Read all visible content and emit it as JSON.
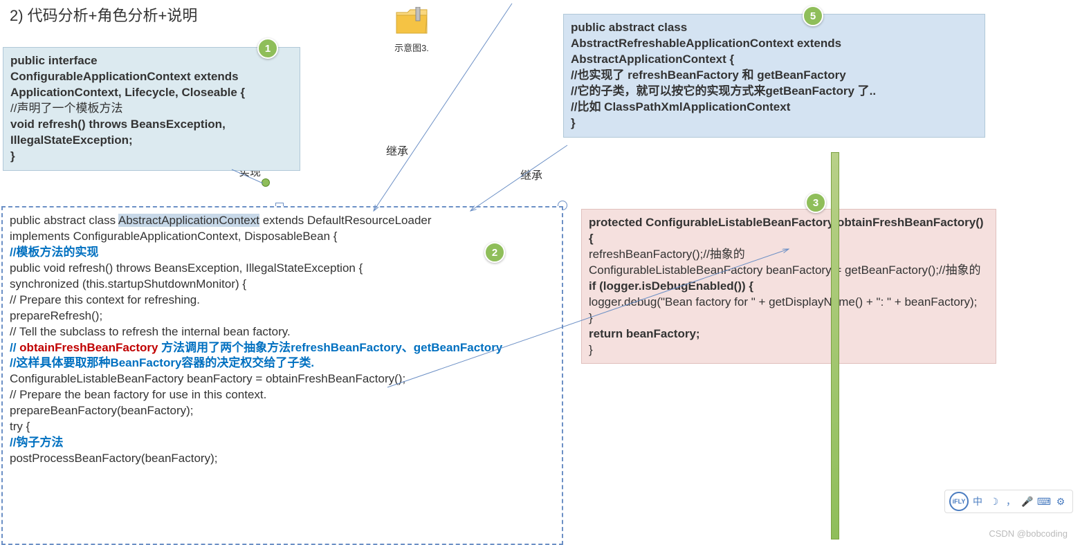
{
  "title": "2)  代码分析+角色分析+说明",
  "folder": {
    "label": "示意图3."
  },
  "labels": {
    "extends1": "继承",
    "extends2": "继承",
    "implements": "实现"
  },
  "box1": {
    "l1": "public interface",
    "l2": "ConfigurableApplicationContext extends",
    "l3": "ApplicationContext, Lifecycle, Closeable {",
    "l4": "//声明了一个模板方法",
    "l5": "void refresh() throws BeansException,",
    "l6": "IllegalStateException;",
    "l7": "}"
  },
  "box5": {
    "l1": "public abstract class",
    "l2": "AbstractRefreshableApplicationContext extends",
    "l3": "AbstractApplicationContext {",
    "l4": "//也实现了 refreshBeanFactory 和 getBeanFactory",
    "l5": "//它的子类，就可以按它的实现方式来getBeanFactory 了..",
    "l6": "//比如 ClassPathXmlApplicationContext",
    "l7": "}"
  },
  "box2": {
    "l1a": "public abstract class ",
    "l1b": "AbstractApplicationContext",
    "l1c": " extends DefaultResourceLoader",
    "l2": "implements ConfigurableApplicationContext, DisposableBean {",
    "l3": "//模板方法的实现",
    "l4": "public void refresh() throws BeansException, IllegalStateException {",
    "l5": "synchronized (this.startupShutdownMonitor) {",
    "l6": "// Prepare this context for refreshing.",
    "l7": "prepareRefresh();",
    "l8": "",
    "l9": "// Tell the subclass to refresh the internal bean factory.",
    "l10a": "// ",
    "l10b": "obtainFreshBeanFactory",
    "l10c": " 方法调用了两个抽象方法refreshBeanFactory、getBeanFactory",
    "l11": "//这样具体要取那种BeanFactory容器的决定权交给了子类.",
    "l12": "ConfigurableListableBeanFactory beanFactory = obtainFreshBeanFactory();",
    "l13": "",
    "l14": "// Prepare the bean factory for use in this context.",
    "l15": "prepareBeanFactory(beanFactory);",
    "l16": "",
    "l17": "try {",
    "l18": "//钩子方法",
    "l19": "postProcessBeanFactory(beanFactory);"
  },
  "box3": {
    "l1": "protected ConfigurableListableBeanFactory obtainFreshBeanFactory() {",
    "l2": "refreshBeanFactory();//抽象的",
    "l3": "ConfigurableListableBeanFactory beanFactory = getBeanFactory();//抽象的",
    "l4": "if (logger.isDebugEnabled()) {",
    "l5": "logger.debug(\"Bean factory for \" + getDisplayName() + \": \" + beanFactory);",
    "l6": "}",
    "l7": "return beanFactory;",
    "l8": "}"
  },
  "badges": {
    "b1": "1",
    "b2": "2",
    "b3": "3",
    "b5": "5"
  },
  "watermark": "CSDN @bobcoding",
  "toolbar": {
    "ifly": "iFLY",
    "cn": "中"
  }
}
